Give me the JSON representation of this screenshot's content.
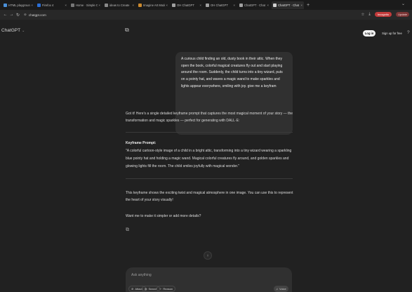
{
  "browser": {
    "tabs": [
      {
        "label": "HTML playground",
        "color": "#4a90d9",
        "active": false
      },
      {
        "label": "Firefox 4",
        "color": "#2b6fd6",
        "active": false
      },
      {
        "label": "Home · Simple Chat",
        "color": "#777777",
        "active": false
      },
      {
        "label": "ideas to Create",
        "color": "#888888",
        "active": false
      },
      {
        "label": "Imagine Art Models",
        "color": "#cc8a2e",
        "active": false
      },
      {
        "label": "OH ChatGPT",
        "color": "#a0a0a0",
        "active": false
      },
      {
        "label": "OH ChatGPT",
        "color": "#a0a0a0",
        "active": false
      },
      {
        "label": "ChatGPT · Chat",
        "color": "#a0a0a0",
        "active": false
      },
      {
        "label": "ChatGPT · Chat",
        "color": "#d0d0d0",
        "active": true
      }
    ],
    "new_tab": "+",
    "url": "chatgpt.com",
    "incognito_label": "Incognito",
    "update_label": "Update"
  },
  "app": {
    "title": "ChatGPT",
    "login_label": "Log in",
    "signup_label": "Sign up for free"
  },
  "conversation": {
    "user_message": "A curious child finding an old, dusty book in their attic. When they open the book, colorful magical creatures fly out and start playing around the room. Suddenly, the child turns into a tiny wizard, puts on a pointy hat, and waves a magic wand to make sparkles and lights appear everywhere, smiling with joy. give me a keyfram",
    "assistant_intro": "Got it! Here's a single detailed keyframe prompt that captures the most magical moment of your story — the transformation and magic sparkles — perfect for generating with DALL·E:",
    "keyframe_title": "Keyframe Prompt:",
    "keyframe_body": "\"A colorful cartoon-style image of a child in a bright attic, transforming into a tiny wizard wearing a sparkling blue pointy hat and holding a magic wand. Magical colorful creatures fly around, and golden sparkles and glowing lights fill the room. The child smiles joyfully with magical wonder.\"",
    "assistant_outro": "This keyframe shows the exciting twist and magical atmosphere in one image. You can use this to represent the heart of your story visually!",
    "assistant_question": "Want me to make it simpler or add more details?"
  },
  "composer": {
    "placeholder": "Ask anything",
    "attach_label": "Attach",
    "search_label": "Search",
    "reason_label": "Reason",
    "voice_label": "Voice"
  },
  "icons": {
    "back": "arrow-left-icon",
    "forward": "arrow-right-icon",
    "reload": "reload-icon",
    "share": "share-icon",
    "copy": "copy-icon",
    "scroll_down": "arrow-down-icon"
  }
}
